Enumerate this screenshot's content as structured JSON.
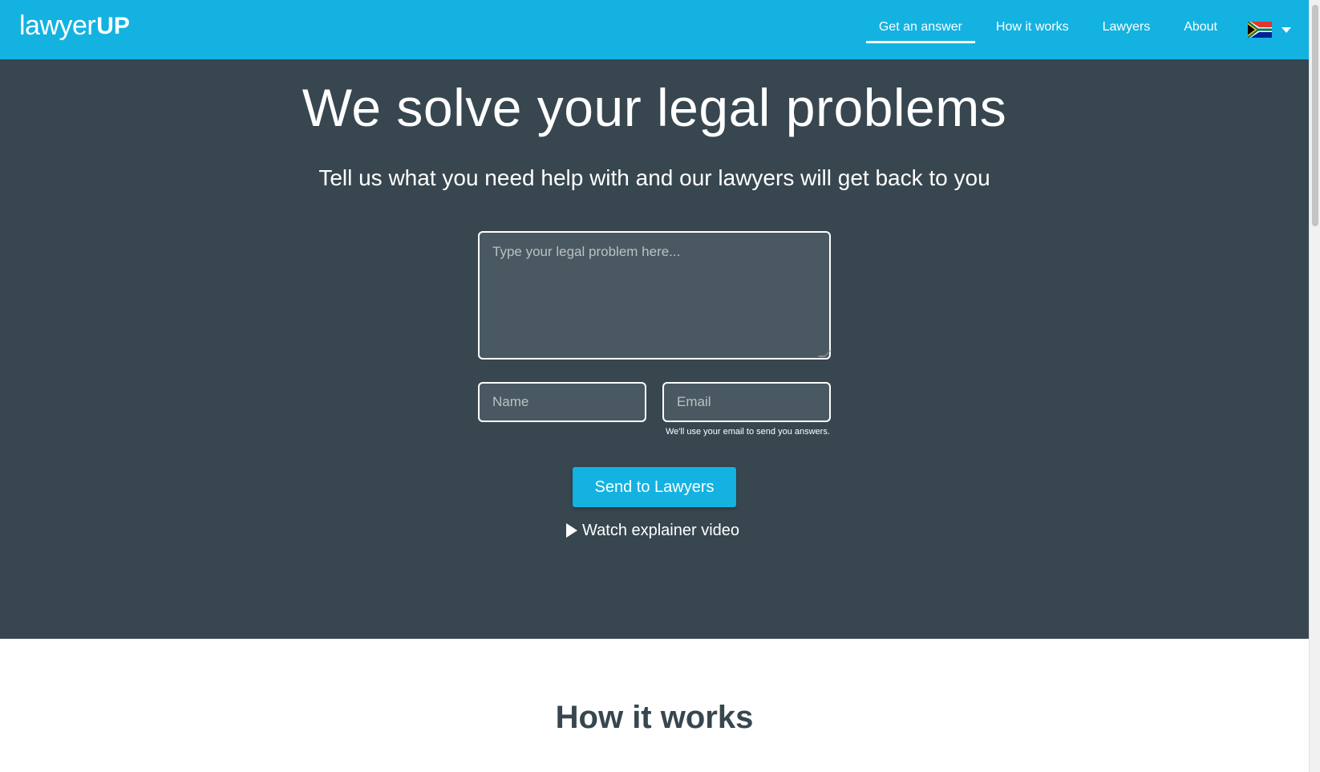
{
  "header": {
    "logo_light": "lawyer",
    "logo_bold": "UP",
    "nav": [
      {
        "label": "Get an answer",
        "active": true
      },
      {
        "label": "How it works",
        "active": false
      },
      {
        "label": "Lawyers",
        "active": false
      },
      {
        "label": "About",
        "active": false
      }
    ],
    "flag_icon": "south-africa-flag-icon"
  },
  "hero": {
    "title": "We solve your legal problems",
    "subtitle": "Tell us what you need help with and our lawyers will get back to you",
    "problem_placeholder": "Type your legal problem here...",
    "name_placeholder": "Name",
    "email_placeholder": "Email",
    "email_hint": "We'll use your email to send you answers.",
    "send_button": "Send to Lawyers",
    "video_link": "Watch explainer video"
  },
  "how_it_works": {
    "title": "How it works"
  },
  "colors": {
    "brand_blue": "#13b2e1",
    "hero_bg": "#37464f",
    "heading_dark": "#37464f"
  }
}
